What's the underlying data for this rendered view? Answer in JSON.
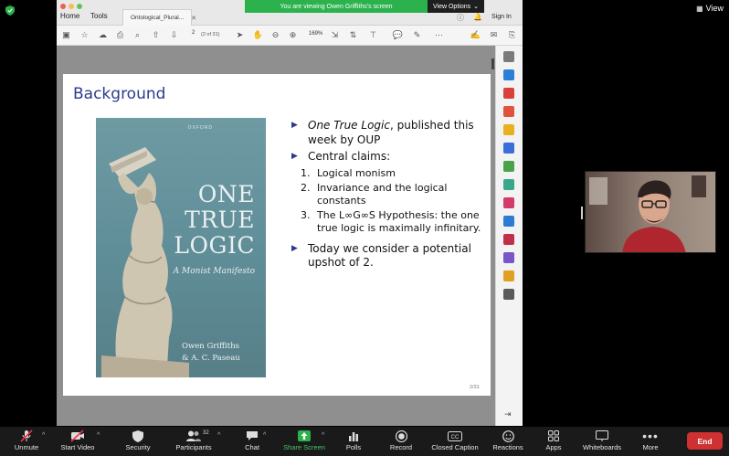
{
  "zoom": {
    "view_button": "View",
    "share_banner": {
      "message": "You are viewing Owen Griffiths's screen",
      "options_label": "View Options"
    },
    "end_button": "End",
    "bottom_bar": [
      {
        "id": "unmute",
        "label": "Unmute",
        "icon": "mic-muted-icon"
      },
      {
        "id": "start-video",
        "label": "Start Video",
        "icon": "video-off-icon"
      },
      {
        "id": "security",
        "label": "Security",
        "icon": "shield-icon"
      },
      {
        "id": "participants",
        "label": "Participants",
        "icon": "people-icon",
        "count": "32"
      },
      {
        "id": "chat",
        "label": "Chat",
        "icon": "chat-icon"
      },
      {
        "id": "share-screen",
        "label": "Share Screen",
        "icon": "share-up-arrow-icon",
        "accent": "#2bb24c"
      },
      {
        "id": "polls",
        "label": "Polls",
        "icon": "bar-chart-icon"
      },
      {
        "id": "record",
        "label": "Record",
        "icon": "record-icon"
      },
      {
        "id": "closed-caption",
        "label": "Closed Caption",
        "icon": "cc-icon"
      },
      {
        "id": "reactions",
        "label": "Reactions",
        "icon": "smiley-icon"
      },
      {
        "id": "apps",
        "label": "Apps",
        "icon": "apps-icon"
      },
      {
        "id": "whiteboards",
        "label": "Whiteboards",
        "icon": "whiteboard-icon"
      },
      {
        "id": "more",
        "label": "More",
        "icon": "more-icon"
      }
    ]
  },
  "pdf": {
    "menu": {
      "home": "Home",
      "tools": "Tools"
    },
    "tab_title": "Ontological_Plural...",
    "sign_in": "Sign In",
    "page_number": "2",
    "page_of": "(2 of 31)",
    "zoom_level": "169%",
    "footer_page": "2/31"
  },
  "slide": {
    "title": "Background",
    "cover": {
      "publisher": "OXFORD",
      "title_lines": [
        "ONE",
        "TRUE",
        "LOGIC"
      ],
      "subtitle": "A Monist Manifesto",
      "authors": [
        "Owen Griffiths",
        "& A. C. Paseau"
      ]
    },
    "bullets": {
      "b1_italic": "One True Logic",
      "b1_rest": ", published this week by OUP",
      "b2": "Central claims:",
      "claims": [
        {
          "n": "1.",
          "text": "Logical monism"
        },
        {
          "n": "2.",
          "text": "Invariance and the logical constants"
        },
        {
          "n": "3.",
          "text": "The L∞G∞S Hypothesis: the one true logic is maximally infinitary."
        }
      ],
      "b3": "Today we consider a potential upshot of 2."
    }
  }
}
